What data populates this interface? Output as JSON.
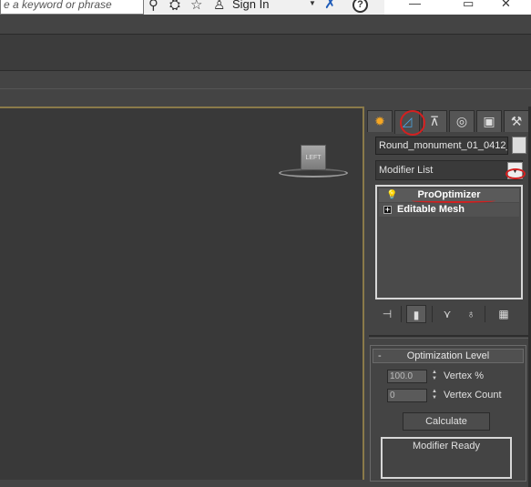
{
  "titlebar": {
    "search_placeholder": "e a keyword or phrase",
    "signin_label": "Sign In",
    "help_label": "?",
    "dropdown_caret": "▼"
  },
  "viewport": {
    "viewcube_label": "LEFT"
  },
  "command_panel": {
    "object_name": "Round_monument_01_0412_",
    "modifier_list_label": "Modifier List",
    "stack": [
      {
        "label": "ProOptimizer",
        "selected": true
      },
      {
        "label": "Editable Mesh",
        "selected": false
      }
    ],
    "rollout": {
      "toggle": "-",
      "title": "Optimization Level",
      "vertex_percent_value": "100.0",
      "vertex_percent_label": "Vertex %",
      "vertex_count_value": "0",
      "vertex_count_label": "Vertex Count",
      "calculate_label": "Calculate",
      "status_text": "Modifier Ready"
    }
  },
  "colors": {
    "background": "#444444",
    "viewport_border": "#8a7a4a",
    "annotation": "#d42020",
    "modify_tab_accent": "#4aa3e0"
  }
}
